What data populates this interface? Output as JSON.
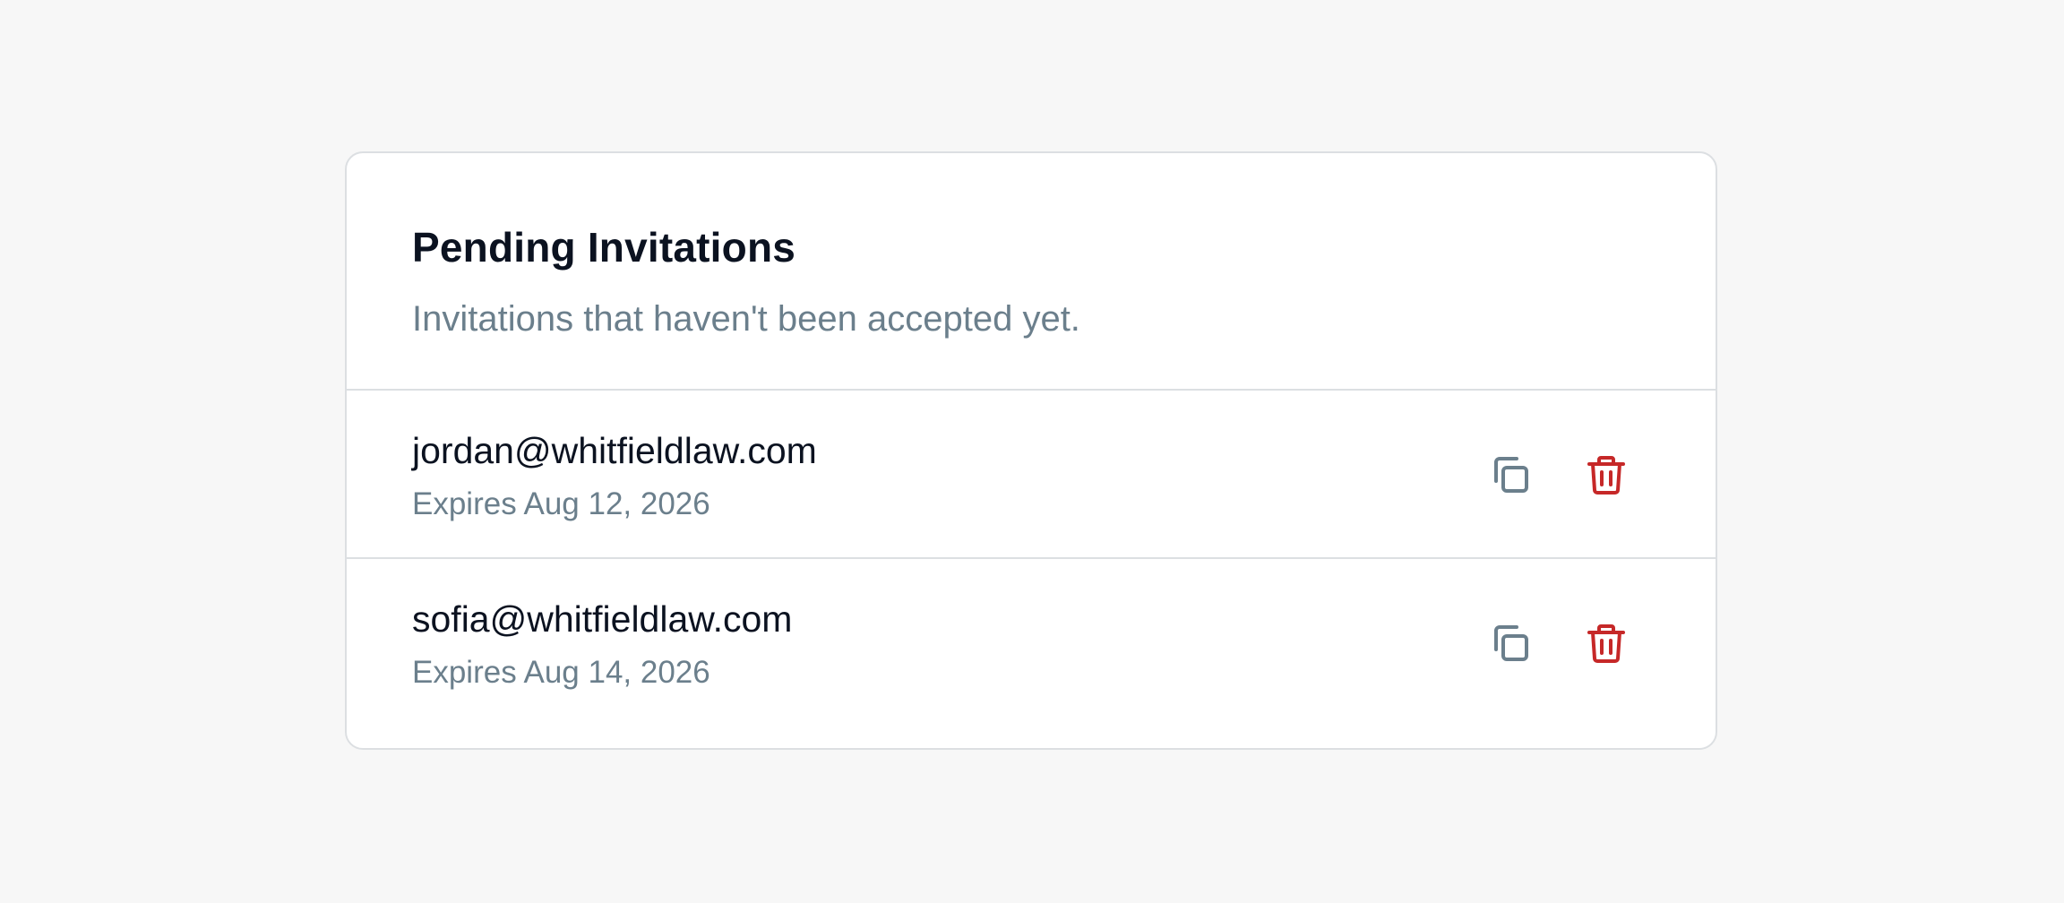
{
  "card": {
    "title": "Pending Invitations",
    "subtitle": "Invitations that haven't been accepted yet."
  },
  "invitations": [
    {
      "email": "jordan@whitfieldlaw.com",
      "expires": "Expires Aug 12, 2026",
      "actions": [
        "copy-icon",
        "trash-icon"
      ]
    },
    {
      "email": "sofia@whitfieldlaw.com",
      "expires": "Expires Aug 14, 2026",
      "actions": [
        "copy-icon",
        "trash-icon"
      ]
    }
  ],
  "colors": {
    "background": "#f7f7f7",
    "card": "#ffffff",
    "border": "#dcdfe2",
    "title": "#0b1220",
    "muted": "#6b7f8c",
    "copy_icon": "#6b7f8c",
    "delete_icon": "#c62828"
  }
}
